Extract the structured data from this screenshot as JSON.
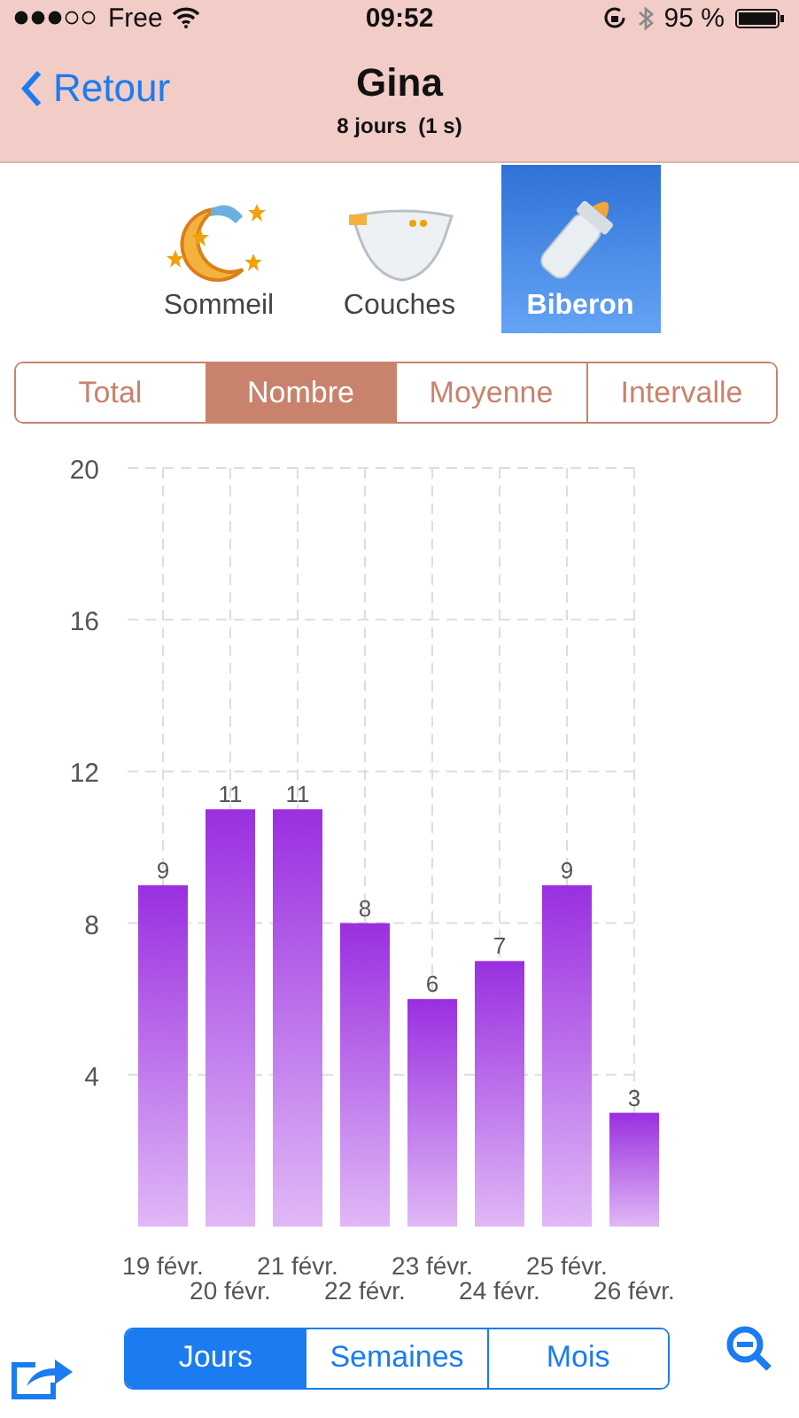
{
  "status_bar": {
    "carrier": "Free",
    "time": "09:52",
    "battery": "95 %"
  },
  "nav_bar": {
    "back": "Retour",
    "title": "Gina",
    "subtitle": "8 jours  (1 s)"
  },
  "categories": [
    {
      "kind": "moon",
      "label": "Sommeil",
      "selected": false
    },
    {
      "kind": "diaper",
      "label": "Couches",
      "selected": false
    },
    {
      "kind": "bottle",
      "label": "Biberon",
      "selected": true
    }
  ],
  "metric_tabs": [
    {
      "label": "Total",
      "selected": false
    },
    {
      "label": "Nombre",
      "selected": true
    },
    {
      "label": "Moyenne",
      "selected": false
    },
    {
      "label": "Intervalle",
      "selected": false
    }
  ],
  "chart": {
    "chart_data": {
      "type": "bar",
      "categories": [
        "19 févr.",
        "20 févr.",
        "21 févr.",
        "22 févr.",
        "23 févr.",
        "24 févr.",
        "25 févr.",
        "26 févr."
      ],
      "values": [
        9,
        11,
        11,
        8,
        6,
        7,
        9,
        3
      ],
      "ylim": [
        0,
        20
      ],
      "yticks": [
        4,
        8,
        12,
        16,
        20
      ],
      "data_labels": true,
      "grid": true
    }
  },
  "period_tabs": [
    {
      "label": "Jours",
      "selected": true
    },
    {
      "label": "Semaines",
      "selected": false
    },
    {
      "label": "Mois",
      "selected": false
    }
  ]
}
